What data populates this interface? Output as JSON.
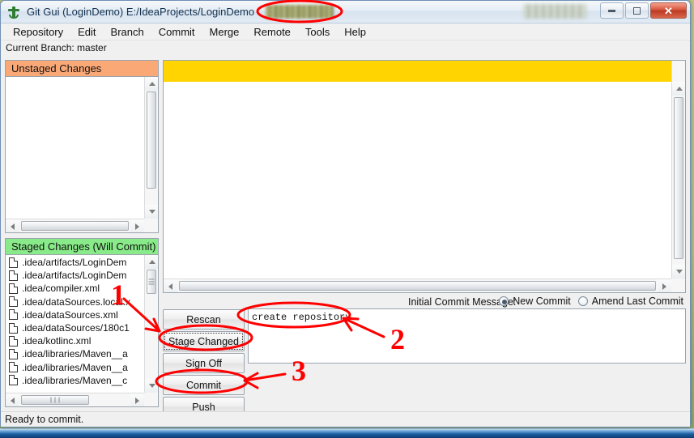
{
  "window": {
    "title": "Git Gui (LoginDemo) E:/IdeaProjects/LoginDemo",
    "app_icon": "git-gui-icon",
    "controls": {
      "minimize": "minimize-icon",
      "maximize": "maximize-icon",
      "close": "✕"
    }
  },
  "menubar": {
    "items": [
      {
        "label": "Repository"
      },
      {
        "label": "Edit"
      },
      {
        "label": "Branch"
      },
      {
        "label": "Commit"
      },
      {
        "label": "Merge"
      },
      {
        "label": "Remote"
      },
      {
        "label": "Tools"
      },
      {
        "label": "Help"
      }
    ]
  },
  "branch": {
    "line": "Current Branch: master"
  },
  "unstaged": {
    "header": "Unstaged Changes",
    "header_color": "#fba877",
    "files": []
  },
  "staged": {
    "header": "Staged Changes (Will Commit)",
    "header_color": "#88ea88",
    "files": [
      ".idea/artifacts/LoginDem",
      ".idea/artifacts/LoginDem",
      ".idea/compiler.xml",
      ".idea/dataSources.local.x",
      ".idea/dataSources.xml",
      ".idea/dataSources/180c1",
      ".idea/kotlinc.xml",
      ".idea/libraries/Maven__a",
      ".idea/libraries/Maven__a",
      ".idea/libraries/Maven__c"
    ]
  },
  "diff": {
    "banner_color": "#ffd400",
    "banner_text": "",
    "body_text": ""
  },
  "commit": {
    "message_label": "Initial Commit Message:",
    "message_value": "create repository",
    "mode_options": [
      {
        "label": "New Commit",
        "selected": true
      },
      {
        "label": "Amend Last Commit",
        "selected": false
      }
    ],
    "buttons": [
      {
        "label": "Rescan",
        "focused": false
      },
      {
        "label": "Stage Changed",
        "focused": true
      },
      {
        "label": "Sign Off",
        "focused": false
      },
      {
        "label": "Commit",
        "focused": false
      },
      {
        "label": "Push",
        "focused": false
      }
    ]
  },
  "statusbar": {
    "text": "Ready to commit."
  },
  "annotations": {
    "color": "#ff0000",
    "marks": [
      {
        "number": "1",
        "points_to": "Stage Changed"
      },
      {
        "number": "2",
        "points_to": "create repository"
      },
      {
        "number": "3",
        "points_to": "Commit"
      }
    ],
    "ellipses": [
      "title-bar-blurred-region",
      "commit-message-field",
      "stage-changed-button",
      "commit-button"
    ]
  }
}
